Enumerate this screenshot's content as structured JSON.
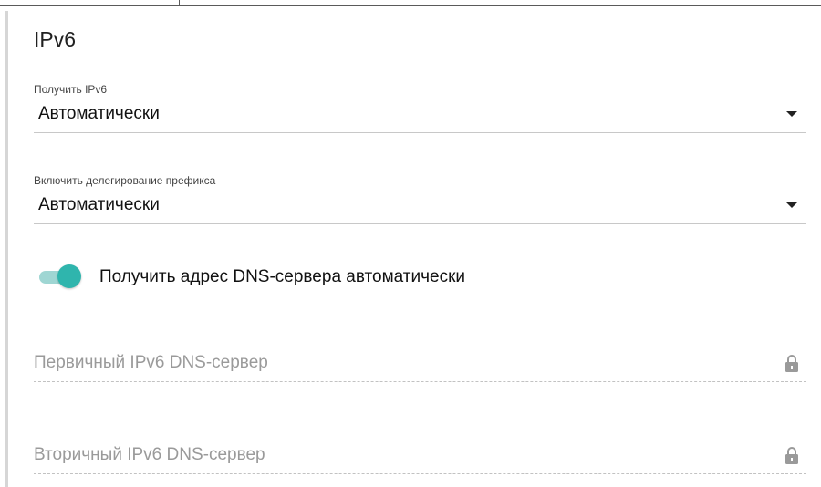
{
  "section": {
    "title": "IPv6"
  },
  "obtain_ipv6": {
    "label": "Получить IPv6",
    "value": "Автоматически"
  },
  "prefix_delegation": {
    "label": "Включить делегирование префикса",
    "value": "Автоматически"
  },
  "dns_auto": {
    "label": "Получить адрес DNS-сервера автоматически",
    "enabled": true,
    "accent_color": "#2fb5ad"
  },
  "primary_dns": {
    "placeholder": "Первичный IPv6 DNS-сервер",
    "value": "",
    "icon": "lock-icon"
  },
  "secondary_dns": {
    "placeholder": "Вторичный IPv6 DNS-сервер",
    "value": "",
    "icon": "lock-icon"
  }
}
